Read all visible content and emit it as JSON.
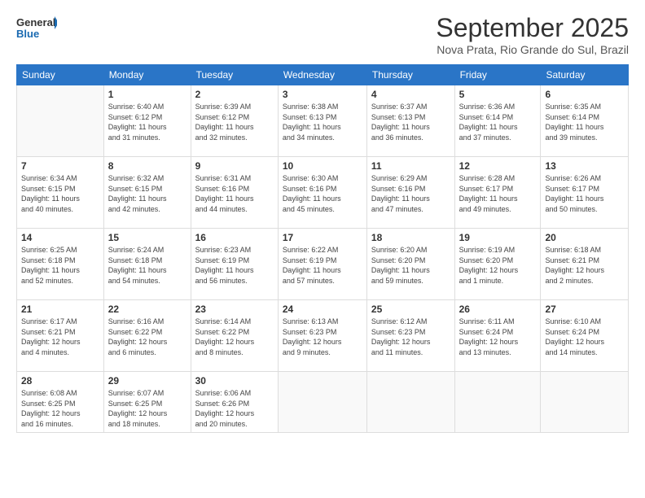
{
  "logo": {
    "line1": "General",
    "line2": "Blue"
  },
  "title": "September 2025",
  "location": "Nova Prata, Rio Grande do Sul, Brazil",
  "weekdays": [
    "Sunday",
    "Monday",
    "Tuesday",
    "Wednesday",
    "Thursday",
    "Friday",
    "Saturday"
  ],
  "weeks": [
    [
      {
        "day": "",
        "info": ""
      },
      {
        "day": "1",
        "info": "Sunrise: 6:40 AM\nSunset: 6:12 PM\nDaylight: 11 hours\nand 31 minutes."
      },
      {
        "day": "2",
        "info": "Sunrise: 6:39 AM\nSunset: 6:12 PM\nDaylight: 11 hours\nand 32 minutes."
      },
      {
        "day": "3",
        "info": "Sunrise: 6:38 AM\nSunset: 6:13 PM\nDaylight: 11 hours\nand 34 minutes."
      },
      {
        "day": "4",
        "info": "Sunrise: 6:37 AM\nSunset: 6:13 PM\nDaylight: 11 hours\nand 36 minutes."
      },
      {
        "day": "5",
        "info": "Sunrise: 6:36 AM\nSunset: 6:14 PM\nDaylight: 11 hours\nand 37 minutes."
      },
      {
        "day": "6",
        "info": "Sunrise: 6:35 AM\nSunset: 6:14 PM\nDaylight: 11 hours\nand 39 minutes."
      }
    ],
    [
      {
        "day": "7",
        "info": "Sunrise: 6:34 AM\nSunset: 6:15 PM\nDaylight: 11 hours\nand 40 minutes."
      },
      {
        "day": "8",
        "info": "Sunrise: 6:32 AM\nSunset: 6:15 PM\nDaylight: 11 hours\nand 42 minutes."
      },
      {
        "day": "9",
        "info": "Sunrise: 6:31 AM\nSunset: 6:16 PM\nDaylight: 11 hours\nand 44 minutes."
      },
      {
        "day": "10",
        "info": "Sunrise: 6:30 AM\nSunset: 6:16 PM\nDaylight: 11 hours\nand 45 minutes."
      },
      {
        "day": "11",
        "info": "Sunrise: 6:29 AM\nSunset: 6:16 PM\nDaylight: 11 hours\nand 47 minutes."
      },
      {
        "day": "12",
        "info": "Sunrise: 6:28 AM\nSunset: 6:17 PM\nDaylight: 11 hours\nand 49 minutes."
      },
      {
        "day": "13",
        "info": "Sunrise: 6:26 AM\nSunset: 6:17 PM\nDaylight: 11 hours\nand 50 minutes."
      }
    ],
    [
      {
        "day": "14",
        "info": "Sunrise: 6:25 AM\nSunset: 6:18 PM\nDaylight: 11 hours\nand 52 minutes."
      },
      {
        "day": "15",
        "info": "Sunrise: 6:24 AM\nSunset: 6:18 PM\nDaylight: 11 hours\nand 54 minutes."
      },
      {
        "day": "16",
        "info": "Sunrise: 6:23 AM\nSunset: 6:19 PM\nDaylight: 11 hours\nand 56 minutes."
      },
      {
        "day": "17",
        "info": "Sunrise: 6:22 AM\nSunset: 6:19 PM\nDaylight: 11 hours\nand 57 minutes."
      },
      {
        "day": "18",
        "info": "Sunrise: 6:20 AM\nSunset: 6:20 PM\nDaylight: 11 hours\nand 59 minutes."
      },
      {
        "day": "19",
        "info": "Sunrise: 6:19 AM\nSunset: 6:20 PM\nDaylight: 12 hours\nand 1 minute."
      },
      {
        "day": "20",
        "info": "Sunrise: 6:18 AM\nSunset: 6:21 PM\nDaylight: 12 hours\nand 2 minutes."
      }
    ],
    [
      {
        "day": "21",
        "info": "Sunrise: 6:17 AM\nSunset: 6:21 PM\nDaylight: 12 hours\nand 4 minutes."
      },
      {
        "day": "22",
        "info": "Sunrise: 6:16 AM\nSunset: 6:22 PM\nDaylight: 12 hours\nand 6 minutes."
      },
      {
        "day": "23",
        "info": "Sunrise: 6:14 AM\nSunset: 6:22 PM\nDaylight: 12 hours\nand 8 minutes."
      },
      {
        "day": "24",
        "info": "Sunrise: 6:13 AM\nSunset: 6:23 PM\nDaylight: 12 hours\nand 9 minutes."
      },
      {
        "day": "25",
        "info": "Sunrise: 6:12 AM\nSunset: 6:23 PM\nDaylight: 12 hours\nand 11 minutes."
      },
      {
        "day": "26",
        "info": "Sunrise: 6:11 AM\nSunset: 6:24 PM\nDaylight: 12 hours\nand 13 minutes."
      },
      {
        "day": "27",
        "info": "Sunrise: 6:10 AM\nSunset: 6:24 PM\nDaylight: 12 hours\nand 14 minutes."
      }
    ],
    [
      {
        "day": "28",
        "info": "Sunrise: 6:08 AM\nSunset: 6:25 PM\nDaylight: 12 hours\nand 16 minutes."
      },
      {
        "day": "29",
        "info": "Sunrise: 6:07 AM\nSunset: 6:25 PM\nDaylight: 12 hours\nand 18 minutes."
      },
      {
        "day": "30",
        "info": "Sunrise: 6:06 AM\nSunset: 6:26 PM\nDaylight: 12 hours\nand 20 minutes."
      },
      {
        "day": "",
        "info": ""
      },
      {
        "day": "",
        "info": ""
      },
      {
        "day": "",
        "info": ""
      },
      {
        "day": "",
        "info": ""
      }
    ]
  ]
}
